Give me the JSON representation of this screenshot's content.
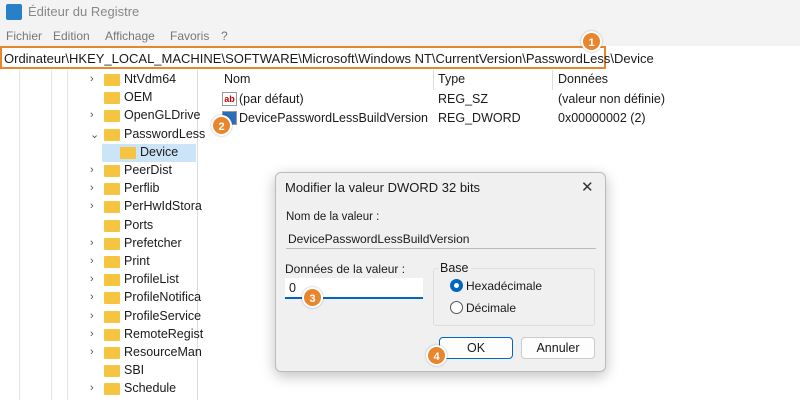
{
  "window": {
    "title": "Éditeur du Registre"
  },
  "menu": [
    "Fichier",
    "Edition",
    "Affichage",
    "Favoris",
    "?"
  ],
  "address": "Ordinateur\\HKEY_LOCAL_MACHINE\\SOFTWARE\\Microsoft\\Windows NT\\CurrentVersion\\PasswordLess\\Device",
  "tree": [
    {
      "label": "NtVdm64",
      "chev": "›"
    },
    {
      "label": "OEM",
      "chev": ""
    },
    {
      "label": "OpenGLDrive",
      "chev": "›"
    },
    {
      "label": "PasswordLess",
      "chev": "⌄"
    },
    {
      "label": "Device",
      "chev": "",
      "child": true,
      "selected": true
    },
    {
      "label": "PeerDist",
      "chev": "›"
    },
    {
      "label": "Perflib",
      "chev": "›"
    },
    {
      "label": "PerHwIdStora",
      "chev": "›"
    },
    {
      "label": "Ports",
      "chev": ""
    },
    {
      "label": "Prefetcher",
      "chev": "›"
    },
    {
      "label": "Print",
      "chev": "›"
    },
    {
      "label": "ProfileList",
      "chev": "›"
    },
    {
      "label": "ProfileNotifica",
      "chev": "›"
    },
    {
      "label": "ProfileService",
      "chev": "›"
    },
    {
      "label": "RemoteRegist",
      "chev": "›"
    },
    {
      "label": "ResourceMan",
      "chev": "›"
    },
    {
      "label": "SBI",
      "chev": ""
    },
    {
      "label": "Schedule",
      "chev": "›"
    }
  ],
  "list": {
    "headers": [
      "Nom",
      "Type",
      "Données"
    ],
    "rows": [
      {
        "icon": "ab",
        "name": "(par défaut)",
        "type": "REG_SZ",
        "data": "(valeur non définie)"
      },
      {
        "icon": "bin",
        "name": "DevicePasswordLessBuildVersion",
        "type": "REG_DWORD",
        "data": "0x00000002 (2)"
      }
    ]
  },
  "dialog": {
    "title": "Modifier la valeur DWORD 32 bits",
    "close": "✕",
    "name_label": "Nom de la valeur :",
    "name_value": "DevicePasswordLessBuildVersion",
    "data_label": "Données de la valeur :",
    "data_value": "0",
    "base_label": "Base",
    "hex": "Hexadécimale",
    "dec": "Décimale",
    "selected_base": "hex",
    "ok": "OK",
    "cancel": "Annuler"
  },
  "badges": [
    "1",
    "2",
    "3",
    "4"
  ],
  "colors": {
    "accent": "#e8862e",
    "selection": "#cce4f7"
  }
}
